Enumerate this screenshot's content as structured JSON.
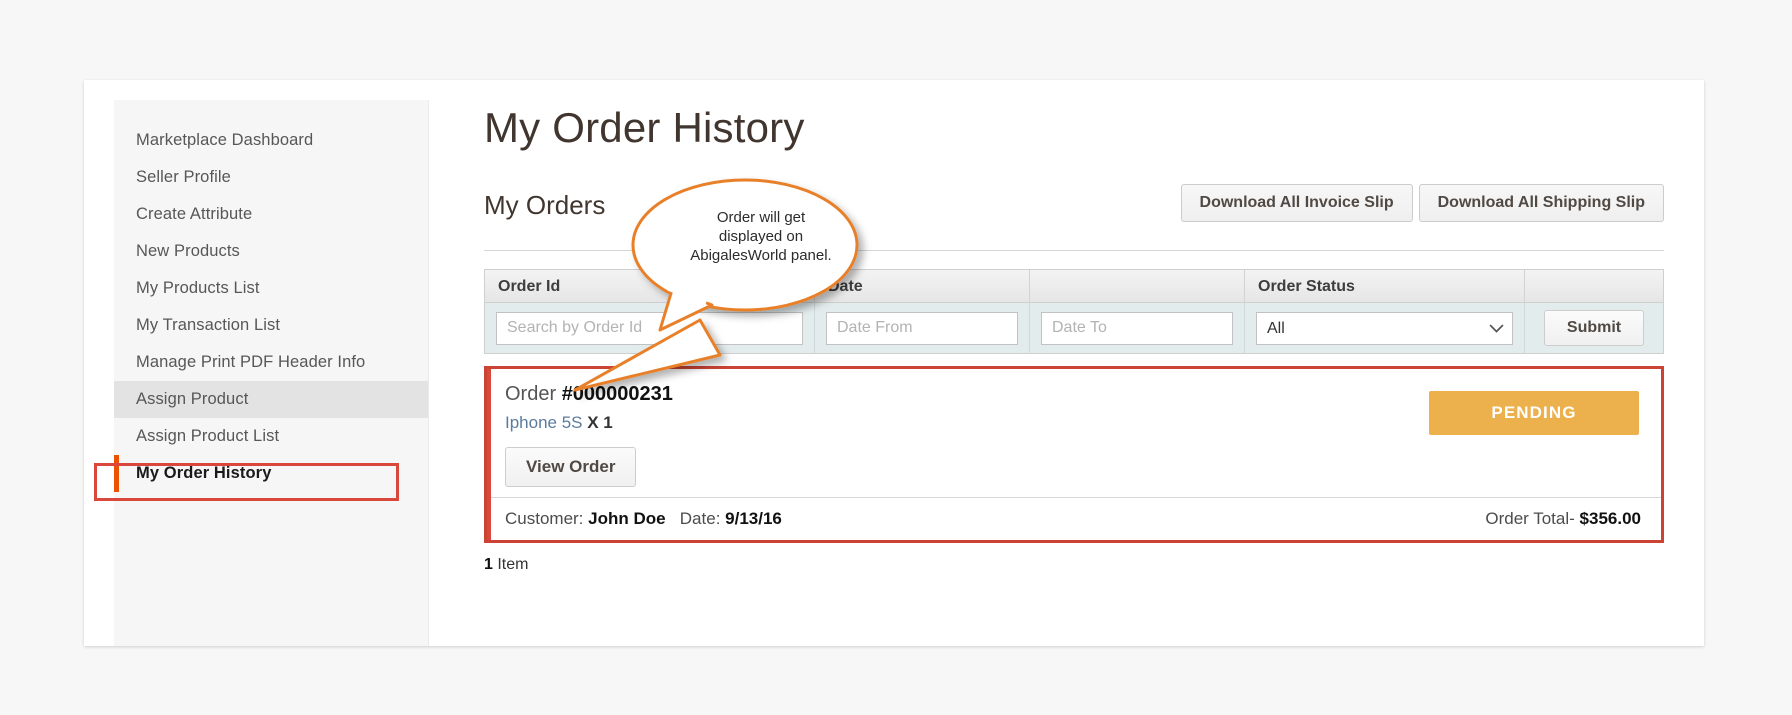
{
  "sidebar": {
    "items": [
      {
        "label": "Marketplace Dashboard",
        "state": "normal"
      },
      {
        "label": "Seller Profile",
        "state": "normal"
      },
      {
        "label": "Create Attribute",
        "state": "normal"
      },
      {
        "label": "New Products",
        "state": "normal"
      },
      {
        "label": "My Products List",
        "state": "normal"
      },
      {
        "label": "My Transaction List",
        "state": "normal"
      },
      {
        "label": "Manage Print PDF Header Info",
        "state": "normal"
      },
      {
        "label": "Assign Product",
        "state": "hover"
      },
      {
        "label": "Assign Product List",
        "state": "normal"
      },
      {
        "label": "My Order History",
        "state": "current"
      }
    ]
  },
  "main": {
    "page_title": "My Order History",
    "section_title": "My Orders",
    "download_invoice_label": "Download All Invoice Slip",
    "download_shipping_label": "Download All Shipping Slip"
  },
  "filters": {
    "headers": [
      "Order Id",
      "Date",
      "",
      "Order Status",
      ""
    ],
    "order_id": {
      "value": "",
      "placeholder": "Search by Order Id"
    },
    "date_from": {
      "value": "",
      "placeholder": "Date From"
    },
    "date_to": {
      "value": "",
      "placeholder": "Date To"
    },
    "order_status": {
      "selected": "All",
      "options": [
        "All"
      ]
    },
    "submit_label": "Submit",
    "chevron_icon": "chevron-down-icon"
  },
  "order": {
    "label": "Order",
    "number": "#000000231",
    "product_name": "Iphone 5S",
    "product_qty": "X 1",
    "view_order_label": "View Order",
    "status": "PENDING",
    "status_color": "#ecb04c",
    "customer_label": "Customer:",
    "customer_name": "John Doe",
    "date_label": "Date:",
    "date_value": "9/13/16",
    "total_label": "Order Total-",
    "total_value": "$356.00",
    "item_count_number": "1",
    "item_count_label": "Item"
  },
  "annotation": {
    "bubble_text": "Order will get displayed on AbigalesWorld panel.",
    "bubble_color": "#e8802a",
    "highlight_color": "#cb4335"
  }
}
